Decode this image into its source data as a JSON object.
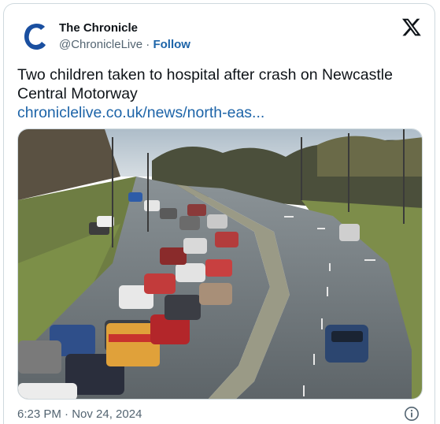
{
  "author": {
    "name": "The Chronicle",
    "handle": "@ChronicleLive",
    "separator": "·",
    "follow_label": "Follow",
    "avatar_letter": "C"
  },
  "platform_icon": "x-logo-icon",
  "tweet": {
    "text": "Two children taken to hospital after crash on Newcastle Central Motorway",
    "link_text": "chroniclelive.co.uk/news/north-eas..."
  },
  "media": {
    "description_icon": "photo"
  },
  "footer": {
    "timestamp": "6:23 PM · Nov 24, 2024",
    "info_icon": "info-icon"
  },
  "colors": {
    "link": "#1d64a8",
    "secondary_text": "#536471",
    "brand_blue": "#1a4fa0"
  }
}
